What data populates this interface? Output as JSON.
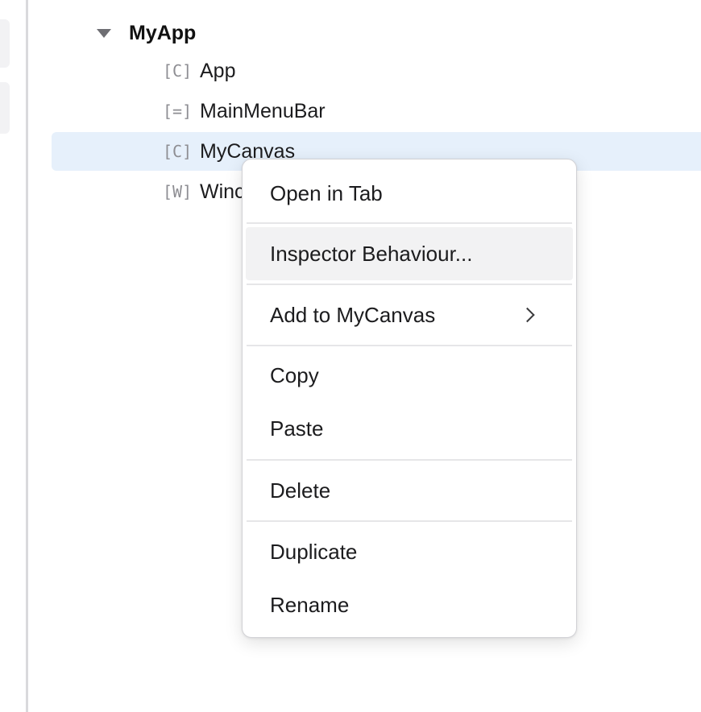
{
  "tree": {
    "root_label": "MyApp",
    "items": [
      {
        "kind": "[C]",
        "name": "App"
      },
      {
        "kind": "[=]",
        "name": "MainMenuBar"
      },
      {
        "kind": "[C]",
        "name": "MyCanvas",
        "selected": true
      },
      {
        "kind": "[W]",
        "name": "Winc"
      }
    ]
  },
  "context_menu": {
    "open_in_tab": "Open in Tab",
    "inspector_behaviour": "Inspector Behaviour...",
    "add_to": "Add to MyCanvas",
    "copy": "Copy",
    "paste": "Paste",
    "delete": "Delete",
    "duplicate": "Duplicate",
    "rename": "Rename"
  },
  "icons": {
    "root_toggle": "caret-down-icon",
    "submenu": "chevron-right-icon"
  },
  "colors": {
    "selection": "#e6f0fb",
    "menu_hover": "#f2f2f3",
    "kind_label": "#8e8e93"
  }
}
